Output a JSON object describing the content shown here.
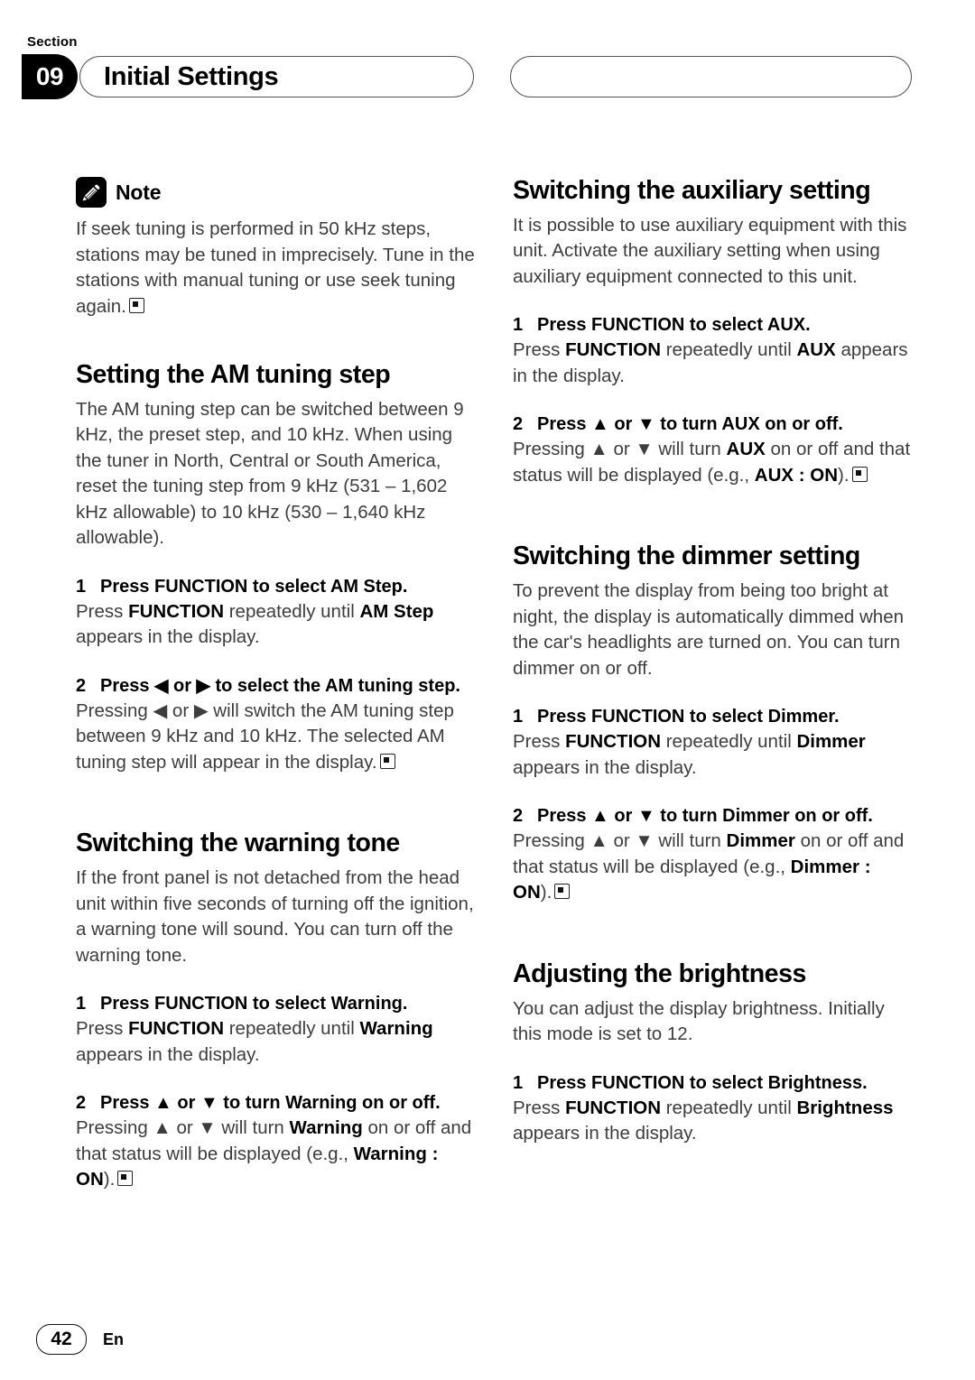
{
  "header": {
    "section_label": "Section",
    "section_number": "09",
    "title": "Initial Settings"
  },
  "footer": {
    "page_number": "42",
    "language": "En"
  },
  "left_column": {
    "note": {
      "icon": "pencil-icon",
      "title": "Note",
      "text": "If seek tuning is performed in 50 kHz steps, stations may be tuned in imprecisely. Tune in the stations with manual tuning or use seek tuning again."
    },
    "am_tuning": {
      "heading": "Setting the AM tuning step",
      "intro": "The AM tuning step can be switched between 9 kHz, the preset step, and 10 kHz. When using the tuner in North, Central or South America, reset the tuning step from 9 kHz (531 – 1,602 kHz allowable) to 10 kHz (530 – 1,640 kHz allowable).",
      "step1_num": "1",
      "step1_head": "Press FUNCTION to select AM Step.",
      "step1_body_a": "Press ",
      "step1_body_b": "FUNCTION",
      "step1_body_c": " repeatedly until ",
      "step1_body_d": "AM Step",
      "step1_body_e": " appears in the display.",
      "step2_num": "2",
      "step2_head": "Press ◀ or ▶ to select the AM tuning step.",
      "step2_body_a": "Pressing ◀ or ▶ will switch the AM tuning step between 9 kHz and 10 kHz. The selected AM tuning step will appear in the display."
    },
    "warning_tone": {
      "heading": "Switching the warning tone",
      "intro": "If the front panel is not detached from the head unit within five seconds of turning off the ignition, a warning tone will sound. You can turn off the warning tone.",
      "step1_num": "1",
      "step1_head": "Press FUNCTION to select Warning.",
      "step1_body_a": "Press ",
      "step1_body_b": "FUNCTION",
      "step1_body_c": " repeatedly until ",
      "step1_body_d": "Warning",
      "step1_body_e": " appears in the display.",
      "step2_num": "2",
      "step2_head": "Press ▲ or ▼ to turn Warning on or off.",
      "step2_body_a": "Pressing ▲ or ▼ will turn ",
      "step2_body_b": "Warning",
      "step2_body_c": " on or off and that status will be displayed (e.g., ",
      "step2_body_d": "Warning : ON",
      "step2_body_e": ")."
    }
  },
  "right_column": {
    "auxiliary": {
      "heading": "Switching the auxiliary setting",
      "intro": "It is possible to use auxiliary equipment with this unit. Activate the auxiliary setting when using auxiliary equipment connected to this unit.",
      "step1_num": "1",
      "step1_head": "Press FUNCTION to select AUX.",
      "step1_body_a": "Press ",
      "step1_body_b": "FUNCTION",
      "step1_body_c": " repeatedly until ",
      "step1_body_d": "AUX",
      "step1_body_e": " appears in the display.",
      "step2_num": "2",
      "step2_head": "Press ▲ or ▼ to turn AUX on or off.",
      "step2_body_a": "Pressing ▲ or ▼ will turn ",
      "step2_body_b": "AUX",
      "step2_body_c": " on or off and that status will be displayed (e.g., ",
      "step2_body_d": "AUX : ON",
      "step2_body_e": ")."
    },
    "dimmer": {
      "heading": "Switching the dimmer setting",
      "intro": "To prevent the display from being too bright at night, the display is automatically dimmed when the car's headlights are turned on. You can turn dimmer on or off.",
      "step1_num": "1",
      "step1_head": "Press FUNCTION to select Dimmer.",
      "step1_body_a": "Press ",
      "step1_body_b": "FUNCTION",
      "step1_body_c": " repeatedly until ",
      "step1_body_d": "Dimmer",
      "step1_body_e": " appears in the display.",
      "step2_num": "2",
      "step2_head": "Press ▲ or ▼ to turn Dimmer on or off.",
      "step2_body_a": "Pressing ▲ or ▼ will turn ",
      "step2_body_b": "Dimmer",
      "step2_body_c": " on or off and that status will be displayed (e.g., ",
      "step2_body_d": "Dimmer : ON",
      "step2_body_e": ")."
    },
    "brightness": {
      "heading": "Adjusting the brightness",
      "intro": "You can adjust the display brightness. Initially this mode is set to 12.",
      "step1_num": "1",
      "step1_head": "Press FUNCTION to select Brightness.",
      "step1_body_a": "Press ",
      "step1_body_b": "FUNCTION",
      "step1_body_c": " repeatedly until ",
      "step1_body_d": "Brightness",
      "step1_body_e": " appears in the display."
    }
  }
}
